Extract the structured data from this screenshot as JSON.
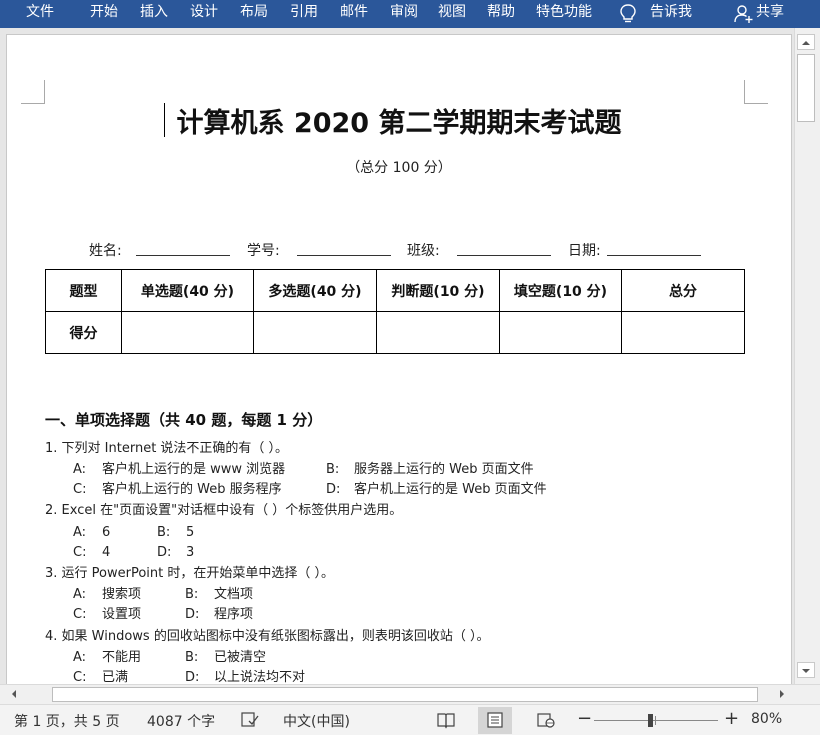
{
  "ribbon": {
    "tabs": [
      "文件",
      "开始",
      "插入",
      "设计",
      "布局",
      "引用",
      "邮件",
      "审阅",
      "视图",
      "帮助",
      "特色功能"
    ],
    "tell_me": "告诉我",
    "share": "共享",
    "background_color": "#2b579a"
  },
  "document": {
    "title": "计算机系 2020 第二学期期末考试题",
    "subtitle": "（总分 100 分）",
    "info_labels": [
      "姓名:",
      "学号:",
      "班级:",
      "日期:"
    ],
    "score_table": {
      "header": [
        "题型",
        "单选题(40 分)",
        "多选题(40 分)",
        "判断题(10 分)",
        "填空题(10 分)",
        "总分"
      ],
      "row_label": "得分"
    },
    "section_heading": "一、单项选择题（共 40 题，每题 1 分）",
    "questions": [
      {
        "text": "1. 下列对 Internet 说法不正确的有（      ）。",
        "options": [
          [
            "A:",
            "客户机上运行的是 www 浏览器"
          ],
          [
            "B:",
            "服务器上运行的 Web 页面文件"
          ],
          [
            "C:",
            "客户机上运行的 Web 服务程序"
          ],
          [
            "D:",
            "客户机上运行的是 Web 页面文件"
          ]
        ]
      },
      {
        "text": "2. Excel 在\"页面设置\"对话框中设有（      ）个标签供用户选用。",
        "options": [
          [
            "A:",
            "6"
          ],
          [
            "B:",
            "5"
          ],
          [
            "C:",
            "4"
          ],
          [
            "D:",
            "3"
          ]
        ]
      },
      {
        "text": "3. 运行 PowerPoint 时，在开始菜单中选择（      ）。",
        "options": [
          [
            "A:",
            "搜索项"
          ],
          [
            "B:",
            "文档项"
          ],
          [
            "C:",
            "设置项"
          ],
          [
            "D:",
            "程序项"
          ]
        ]
      },
      {
        "text": "4. 如果 Windows 的回收站图标中没有纸张图标露出，则表明该回收站（      ）。",
        "options": [
          [
            "A:",
            "不能用"
          ],
          [
            "B:",
            "已被清空"
          ],
          [
            "C:",
            "已满"
          ],
          [
            "D:",
            "以上说法均不对"
          ]
        ]
      }
    ]
  },
  "statusbar": {
    "page": "第 1 页，共 5 页",
    "word_count": "4087 个字",
    "language": "中文(中国)",
    "zoom": "80%",
    "zoom_minus": "−",
    "zoom_plus": "+",
    "zoom_level_fraction": 0.5
  }
}
